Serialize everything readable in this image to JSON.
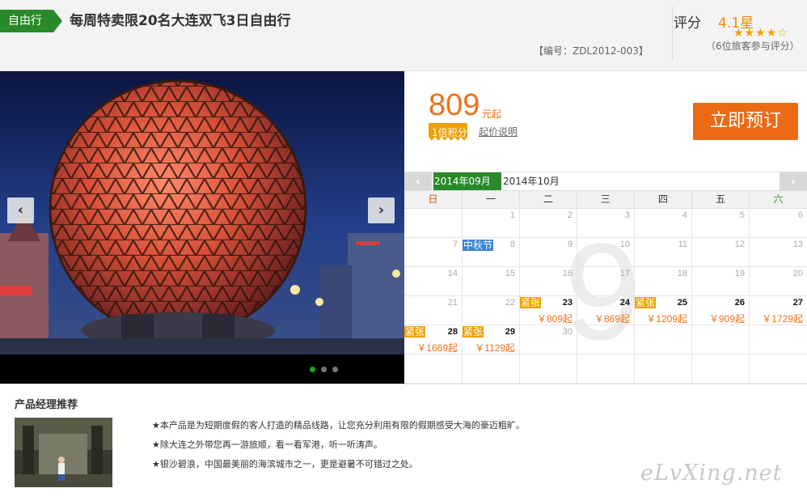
{
  "header": {
    "tag": "自由行",
    "title": "每周特卖限20名大连双飞3日自由行",
    "code": "【编号：ZDL2012-003】",
    "rating_label": "评分",
    "rating_score": "4.1星",
    "stars": "★★★★☆",
    "rating_count": "（6位旅客参与评分）"
  },
  "price_box": {
    "price": "809",
    "unit": "元起",
    "points_badge": "1倍积分",
    "price_note": "起价说明",
    "book_button": "立即预订"
  },
  "calendar": {
    "prev_month": "‹",
    "next_month": "›",
    "months": [
      "2014年09月",
      "2014年10月"
    ],
    "weekdays": [
      "日",
      "一",
      "二",
      "三",
      "四",
      "五",
      "六"
    ],
    "big_month": "9",
    "days": [
      {
        "day": "",
        "tag": "",
        "price": ""
      },
      {
        "day": "1",
        "tag": "",
        "price": ""
      },
      {
        "day": "2",
        "tag": "",
        "price": ""
      },
      {
        "day": "3",
        "tag": "",
        "price": ""
      },
      {
        "day": "4",
        "tag": "",
        "price": ""
      },
      {
        "day": "5",
        "tag": "",
        "price": ""
      },
      {
        "day": "6",
        "tag": "",
        "price": ""
      },
      {
        "day": "7",
        "tag": "",
        "price": ""
      },
      {
        "day": "8",
        "tag": "",
        "price": "",
        "holiday": "中秋节"
      },
      {
        "day": "9",
        "tag": "",
        "price": ""
      },
      {
        "day": "10",
        "tag": "",
        "price": ""
      },
      {
        "day": "11",
        "tag": "",
        "price": ""
      },
      {
        "day": "12",
        "tag": "",
        "price": ""
      },
      {
        "day": "13",
        "tag": "",
        "price": ""
      },
      {
        "day": "14",
        "tag": "",
        "price": ""
      },
      {
        "day": "15",
        "tag": "",
        "price": ""
      },
      {
        "day": "16",
        "tag": "",
        "price": ""
      },
      {
        "day": "17",
        "tag": "",
        "price": ""
      },
      {
        "day": "18",
        "tag": "",
        "price": ""
      },
      {
        "day": "19",
        "tag": "",
        "price": ""
      },
      {
        "day": "20",
        "tag": "",
        "price": ""
      },
      {
        "day": "21",
        "tag": "",
        "price": ""
      },
      {
        "day": "22",
        "tag": "",
        "price": ""
      },
      {
        "day": "23",
        "tag": "紧张",
        "price": "￥809起"
      },
      {
        "day": "24",
        "tag": "",
        "price": "￥869起"
      },
      {
        "day": "25",
        "tag": "紧张",
        "price": "￥1209起"
      },
      {
        "day": "26",
        "tag": "",
        "price": "￥909起"
      },
      {
        "day": "27",
        "tag": "",
        "price": "￥1729起"
      },
      {
        "day": "28",
        "tag": "紧张",
        "price": "￥1669起"
      },
      {
        "day": "29",
        "tag": "紧张",
        "price": "￥1129起"
      },
      {
        "day": "30",
        "tag": "",
        "price": ""
      },
      {
        "day": "",
        "tag": "",
        "price": ""
      },
      {
        "day": "",
        "tag": "",
        "price": ""
      },
      {
        "day": "",
        "tag": "",
        "price": ""
      },
      {
        "day": "",
        "tag": "",
        "price": ""
      },
      {
        "day": "",
        "tag": "",
        "price": ""
      },
      {
        "day": "",
        "tag": "",
        "price": ""
      },
      {
        "day": "",
        "tag": "",
        "price": ""
      },
      {
        "day": "",
        "tag": "",
        "price": ""
      },
      {
        "day": "",
        "tag": "",
        "price": ""
      },
      {
        "day": "",
        "tag": "",
        "price": ""
      },
      {
        "day": "",
        "tag": "",
        "price": ""
      }
    ]
  },
  "recommendation": {
    "title": "产品经理推荐",
    "lines": [
      "★本产品是为短期度假的客人打造的精品线路，让您充分利用有限的假期感受大海的豪迈粗旷。",
      "★除大连之外带您再一游旅顺，看一看军港，听一听涛声。",
      "★银沙碧浪，中国最美丽的海滨城市之一，更是避暑不可错过之处。"
    ],
    "watermark": "eLvXing.net"
  },
  "icons": {
    "prev": "chevron-left-icon",
    "next": "chevron-right-icon",
    "star": "star-icon"
  },
  "colors": {
    "accent_orange": "#ec6a14",
    "price_orange": "#f0701a",
    "brand_green": "#2a8a2a",
    "tag_amber": "#f0a000",
    "holiday_blue": "#3b86d4"
  }
}
